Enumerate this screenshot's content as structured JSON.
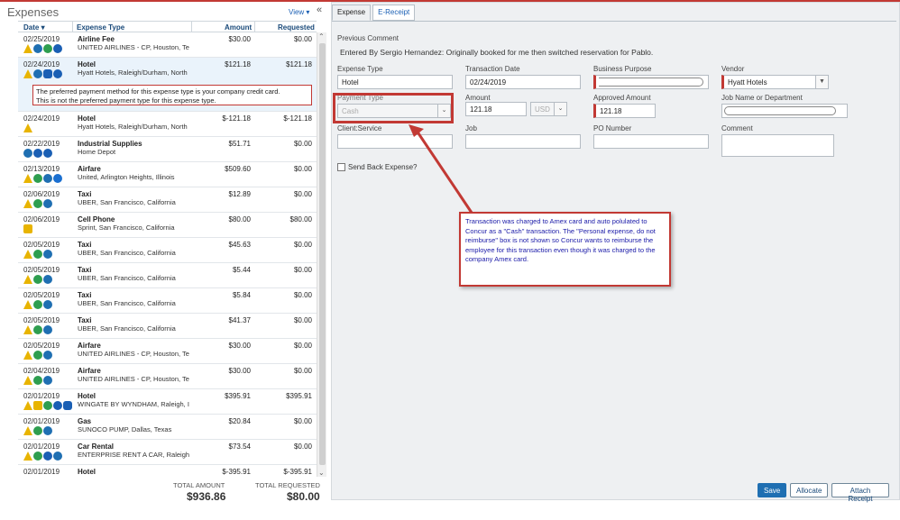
{
  "left": {
    "title": "Expenses",
    "view_label": "View ▾",
    "collapse_glyph": "«",
    "columns": {
      "date": "Date ▾",
      "type": "Expense Type",
      "amount": "Amount",
      "requested": "Requested"
    },
    "message": "The preferred payment method for this expense type is your company credit card.\nThis is not the preferred payment type for this expense type.",
    "rows": [
      {
        "date": "02/25/2019",
        "type": "Airline Fee",
        "vendor": "UNITED AIRLINES - CP, Houston, Te",
        "amount": "$30.00",
        "requested": "$0.00",
        "icons": [
          "warn",
          "card",
          "eq",
          "receipt"
        ]
      },
      {
        "date": "02/24/2019",
        "type": "Hotel",
        "vendor": "Hyatt Hotels, Raleigh/Durham, North",
        "amount": "$121.18",
        "requested": "$121.18",
        "icons": [
          "warn",
          "card",
          "hotel",
          "receipt"
        ],
        "selected": true
      },
      {
        "date": "02/24/2019",
        "type": "Hotel",
        "vendor": "Hyatt Hotels, Raleigh/Durham, North",
        "amount": "$-121.18",
        "requested": "$-121.18",
        "icons": [
          "warn"
        ]
      },
      {
        "date": "02/22/2019",
        "type": "Industrial Supplies",
        "vendor": "Home Depot",
        "amount": "$51.71",
        "requested": "$0.00",
        "icons": [
          "card",
          "receipt",
          "receipt"
        ]
      },
      {
        "date": "02/13/2019",
        "type": "Airfare",
        "vendor": "United, Arlington Heights, Illinois",
        "amount": "$509.60",
        "requested": "$0.00",
        "icons": [
          "warn",
          "eq",
          "card",
          "plus"
        ]
      },
      {
        "date": "02/06/2019",
        "type": "Taxi",
        "vendor": "UBER, San Francisco, California",
        "amount": "$12.89",
        "requested": "$0.00",
        "icons": [
          "warn",
          "eq",
          "card"
        ]
      },
      {
        "date": "02/06/2019",
        "type": "Cell Phone",
        "vendor": "Sprint, San Francisco, California",
        "amount": "$80.00",
        "requested": "$80.00",
        "icons": [
          "yellow"
        ]
      },
      {
        "date": "02/05/2019",
        "type": "Taxi",
        "vendor": "UBER, San Francisco, California",
        "amount": "$45.63",
        "requested": "$0.00",
        "icons": [
          "warn",
          "eq",
          "card"
        ]
      },
      {
        "date": "02/05/2019",
        "type": "Taxi",
        "vendor": "UBER, San Francisco, California",
        "amount": "$5.44",
        "requested": "$0.00",
        "icons": [
          "warn",
          "eq",
          "card"
        ]
      },
      {
        "date": "02/05/2019",
        "type": "Taxi",
        "vendor": "UBER, San Francisco, California",
        "amount": "$5.84",
        "requested": "$0.00",
        "icons": [
          "warn",
          "eq",
          "card"
        ]
      },
      {
        "date": "02/05/2019",
        "type": "Taxi",
        "vendor": "UBER, San Francisco, California",
        "amount": "$41.37",
        "requested": "$0.00",
        "icons": [
          "warn",
          "eq",
          "card"
        ]
      },
      {
        "date": "02/05/2019",
        "type": "Airfare",
        "vendor": "UNITED AIRLINES - CP, Houston, Te",
        "amount": "$30.00",
        "requested": "$0.00",
        "icons": [
          "warn",
          "eq",
          "card"
        ]
      },
      {
        "date": "02/04/2019",
        "type": "Airfare",
        "vendor": "UNITED AIRLINES - CP, Houston, Te",
        "amount": "$30.00",
        "requested": "$0.00",
        "icons": [
          "warn",
          "eq",
          "card"
        ]
      },
      {
        "date": "02/01/2019",
        "type": "Hotel",
        "vendor": "WINGATE BY WYNDHAM, Raleigh, I",
        "amount": "$395.91",
        "requested": "$395.91",
        "icons": [
          "warn",
          "yellow",
          "eq",
          "receipt",
          "hotel"
        ]
      },
      {
        "date": "02/01/2019",
        "type": "Gas",
        "vendor": "SUNOCO PUMP, Dallas, Texas",
        "amount": "$20.84",
        "requested": "$0.00",
        "icons": [
          "warn",
          "eq",
          "card"
        ]
      },
      {
        "date": "02/01/2019",
        "type": "Car Rental",
        "vendor": "ENTERPRISE RENT A CAR, Raleigh",
        "amount": "$73.54",
        "requested": "$0.00",
        "icons": [
          "warn",
          "eq",
          "receipt",
          "card"
        ]
      },
      {
        "date": "02/01/2019",
        "type": "Hotel",
        "vendor": "",
        "amount": "$-395.91",
        "requested": "$-395.91",
        "icons": []
      }
    ],
    "totals": {
      "amount_label": "TOTAL AMOUNT",
      "amount": "$936.86",
      "requested_label": "TOTAL REQUESTED",
      "requested": "$80.00"
    }
  },
  "right": {
    "tabs": [
      "Expense",
      "E-Receipt"
    ],
    "previous_comment_label": "Previous Comment",
    "previous_comment": "Entered By Sergio Hernandez: Originally booked for me then switched reservation for Pablo.",
    "fields": {
      "expense_type": {
        "label": "Expense Type",
        "value": "Hotel"
      },
      "transaction_date": {
        "label": "Transaction Date",
        "value": "02/24/2019"
      },
      "business_purpose": {
        "label": "Business Purpose",
        "value": ""
      },
      "vendor": {
        "label": "Vendor",
        "value": "Hyatt Hotels"
      },
      "payment_type": {
        "label": "Payment Type",
        "value": "Cash"
      },
      "amount": {
        "label": "Amount",
        "value": "121.18",
        "currency": "USD"
      },
      "approved_amount": {
        "label": "Approved Amount",
        "value": "121.18"
      },
      "job_name": {
        "label": "Job Name or Department",
        "value": ""
      },
      "client_service": {
        "label": "Client:Service",
        "value": ""
      },
      "job": {
        "label": "Job",
        "value": ""
      },
      "po_number": {
        "label": "PO Number",
        "value": ""
      },
      "comment": {
        "label": "Comment",
        "value": ""
      }
    },
    "send_back_label": "Send Back Expense?",
    "callout": "Transaction was charged to Amex card and auto polulated to Concur as a \"Cash\" transaction.  The \"Personal expense, do not reimburse\" box is not shown so Concur wants to reimburse the employee for this transaction even though it was charged to the company Amex card.",
    "buttons": {
      "save": "Save",
      "allocate": "Allocate",
      "attach_receipt": "Attach Receipt"
    }
  },
  "colors": {
    "accent": "#1f6fb2",
    "alert": "#c23934",
    "callout_text": "#1a1aa8"
  }
}
